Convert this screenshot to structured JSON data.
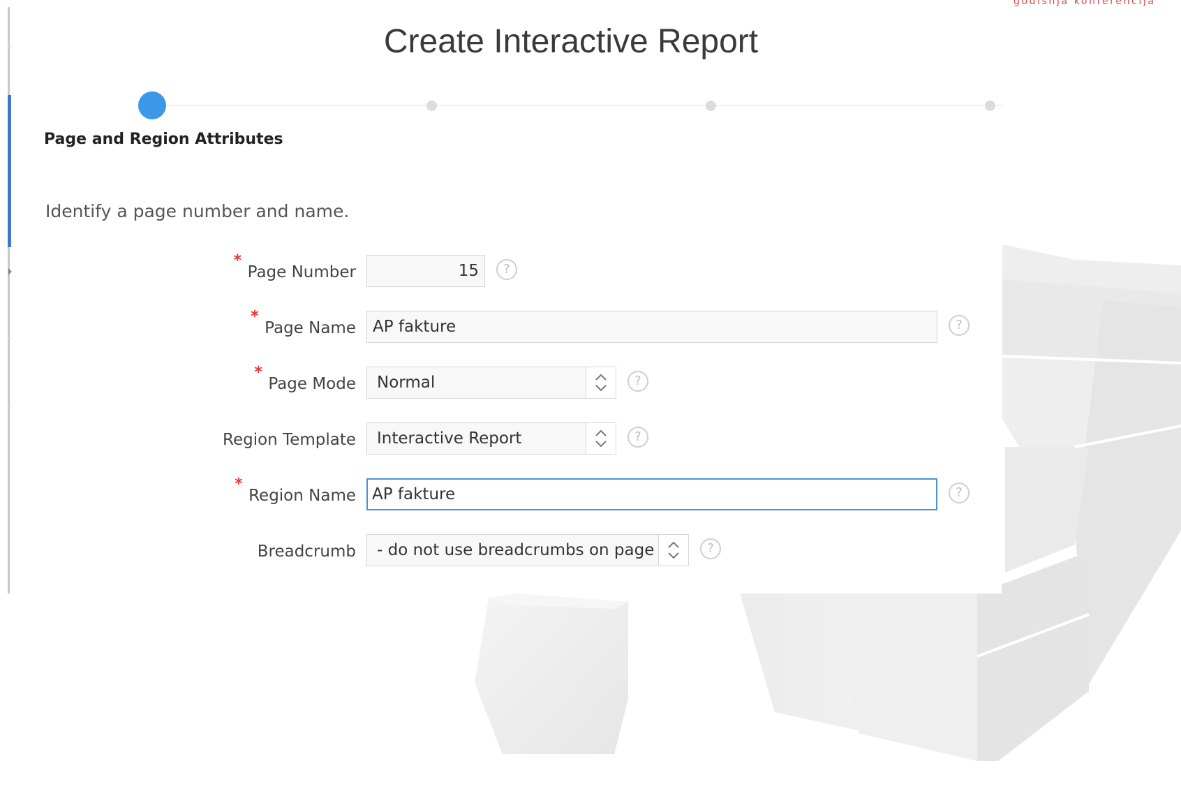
{
  "brand": {
    "text": "godišnja konferencija",
    "accent_color": "#e02a2a"
  },
  "dialog": {
    "title": "Create Interactive Report"
  },
  "wizard": {
    "active_step_label": "Page and Region Attributes",
    "active_color": "#3b97e8"
  },
  "intro": "Identify a page number and name.",
  "form": {
    "page_number": {
      "label": "Page Number",
      "required": true,
      "value": "15"
    },
    "page_name": {
      "label": "Page Name",
      "required": true,
      "value": "AP fakture"
    },
    "page_mode": {
      "label": "Page Mode",
      "required": true,
      "value": "Normal"
    },
    "region_template": {
      "label": "Region Template",
      "required": false,
      "value": "Interactive Report"
    },
    "region_name": {
      "label": "Region Name",
      "required": true,
      "value": "AP fakture"
    },
    "breadcrumb": {
      "label": "Breadcrumb",
      "required": false,
      "value": "- do not use breadcrumbs on page -"
    }
  },
  "required_marker": "*",
  "help_glyph": "?",
  "focus_color": "#4a90d9",
  "required_color": "#e53935"
}
